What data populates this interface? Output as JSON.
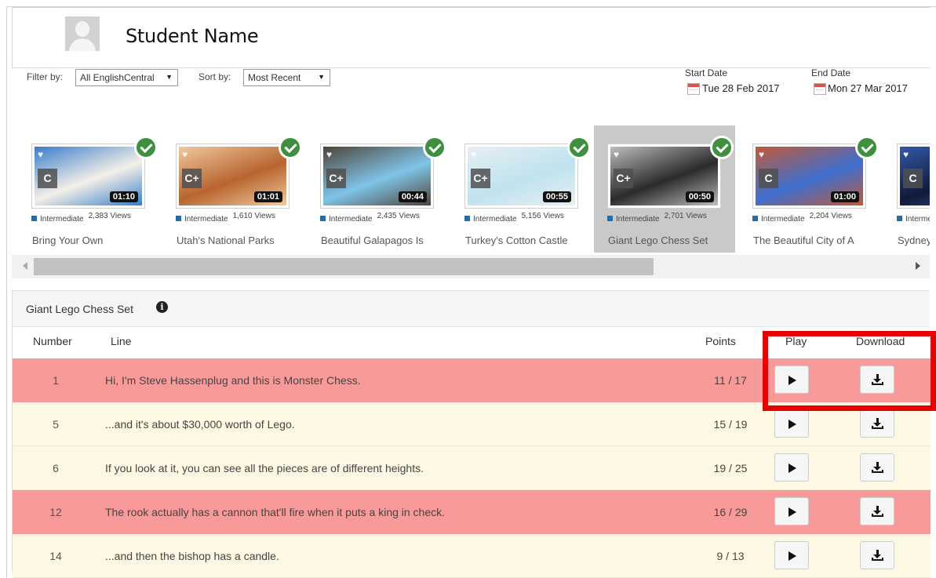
{
  "header": {
    "student_name": "Student Name"
  },
  "filters": {
    "filter_label": "Filter by:",
    "filter_value": "All EnglishCentral",
    "sort_label": "Sort by:",
    "sort_value": "Most Recent",
    "start_label": "Start Date",
    "start_value": "Tue 28 Feb 2017",
    "end_label": "End Date",
    "end_value": "Mon 27 Mar 2017"
  },
  "videos": [
    {
      "title": "Bring Your Own",
      "level_badge": "C",
      "duration": "01:10",
      "level": "Intermediate",
      "views": "2,383 Views",
      "selected": false,
      "palette": [
        "#f4f0e8",
        "#3a7dc9"
      ]
    },
    {
      "title": "Utah's National Parks",
      "level_badge": "C+",
      "duration": "01:01",
      "level": "Intermediate",
      "views": "1,610 Views",
      "selected": false,
      "palette": [
        "#b8652e",
        "#f0c9a0"
      ]
    },
    {
      "title": "Beautiful Galapagos Is",
      "level_badge": "C+",
      "duration": "00:44",
      "level": "Intermediate",
      "views": "2,435 Views",
      "selected": false,
      "palette": [
        "#7fc4e8",
        "#4e4438"
      ]
    },
    {
      "title": "Turkey's Cotton Castle",
      "level_badge": "C+",
      "duration": "00:55",
      "level": "Intermediate",
      "views": "5,156 Views",
      "selected": false,
      "palette": [
        "#bfe3ef",
        "#e9eef2"
      ]
    },
    {
      "title": "Giant Lego Chess Set",
      "level_badge": "C+",
      "duration": "00:50",
      "level": "Intermediate",
      "views": "2,701 Views",
      "selected": true,
      "palette": [
        "#2b2b2b",
        "#bdbdbd"
      ]
    },
    {
      "title": "The Beautiful City of A",
      "level_badge": "C",
      "duration": "01:00",
      "level": "Intermediate",
      "views": "2,204 Views",
      "selected": false,
      "palette": [
        "#3f6fcf",
        "#c05a38"
      ]
    },
    {
      "title": "Sydney's",
      "level_badge": "C",
      "duration": "",
      "level": "Interme",
      "views": "",
      "selected": false,
      "palette": [
        "#101a3a",
        "#3358a8"
      ]
    }
  ],
  "detail": {
    "title": "Giant Lego Chess Set",
    "columns": {
      "number": "Number",
      "line": "Line",
      "points": "Points",
      "play": "Play",
      "download": "Download"
    },
    "rows": [
      {
        "number": "1",
        "line": "Hi, I'm Steve Hassenplug and this is Monster Chess.",
        "points": "11 / 17",
        "status": "red"
      },
      {
        "number": "5",
        "line": "...and it's about $30,000 worth of Lego.",
        "points": "15 / 19",
        "status": "cream"
      },
      {
        "number": "6",
        "line": "If you look at it, you can see all the pieces are of different heights.",
        "points": "19 / 25",
        "status": "cream"
      },
      {
        "number": "12",
        "line": "The rook actually has a cannon that'll fire when it puts a king in check.",
        "points": "16 / 29",
        "status": "red"
      },
      {
        "number": "14",
        "line": "...and then the bishop has a candle.",
        "points": "9 / 13",
        "status": "cream"
      }
    ]
  },
  "icons": {
    "check": "check-circle-icon",
    "play": "play-icon",
    "download": "download-icon",
    "info": "info-icon",
    "calendar": "calendar-icon"
  },
  "colors": {
    "incorrect_row": "#f99a9a",
    "ok_row": "#fcf8e3",
    "highlight": "#e60000",
    "check": "#3f8f3f"
  }
}
